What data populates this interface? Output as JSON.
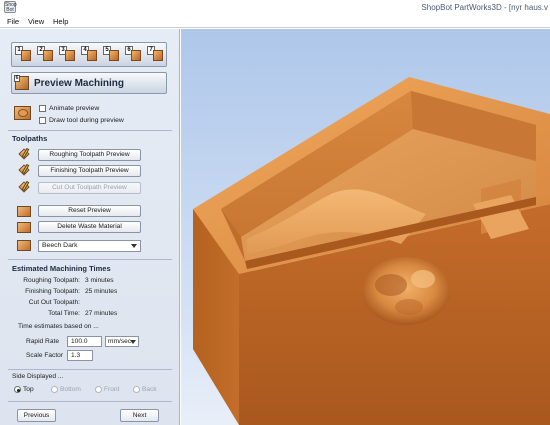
{
  "window": {
    "app_icon_text": "Shop Bot",
    "title": "ShopBot PartWorks3D - [nyr haus.v"
  },
  "menu": [
    "File",
    "View",
    "Help"
  ],
  "steps": [
    {
      "num": "1",
      "icon": "model-step-icon"
    },
    {
      "num": "2",
      "icon": "model-step-icon"
    },
    {
      "num": "3",
      "icon": "model-step-icon"
    },
    {
      "num": "4",
      "icon": "model-step-icon"
    },
    {
      "num": "5",
      "icon": "model-step-icon"
    },
    {
      "num": "6",
      "icon": "model-step-icon"
    },
    {
      "num": "7",
      "icon": "model-step-icon"
    }
  ],
  "section": {
    "num": "6",
    "title": "Preview Machining"
  },
  "options": {
    "animate_preview": "Animate preview",
    "draw_tool": "Draw tool during preview"
  },
  "toolpaths": {
    "heading": "Toolpaths",
    "roughing_btn": "Roughing Toolpath Preview",
    "finishing_btn": "Finishing Toolpath Preview",
    "cutout_btn": "Cut Out Toolpath Preview",
    "reset_btn": "Reset Preview",
    "delete_btn": "Delete Waste Material",
    "material_selected": "Beech Dark"
  },
  "times": {
    "heading": "Estimated Machining Times",
    "rows": [
      {
        "label": "Roughing Toolpath:",
        "value": "3 minutes"
      },
      {
        "label": "Finishing Toolpath:",
        "value": "25 minutes"
      },
      {
        "label": "Cut Out Toolpath:",
        "value": ""
      },
      {
        "label": "Total Time:",
        "value": "27 minutes"
      }
    ],
    "based_on": "Time estimates based on ...",
    "rapid_rate_label": "Rapid Rate",
    "rapid_rate_value": "100.0",
    "rapid_rate_units": "mm/sec",
    "scale_factor_label": "Scale Factor",
    "scale_factor_value": "1.3"
  },
  "side": {
    "heading": "Side Displayed ...",
    "options": [
      "Top",
      "Bottom",
      "Front",
      "Back"
    ],
    "selected": "Top"
  },
  "nav": {
    "previous": "Previous",
    "next": "Next"
  },
  "colors": {
    "wood_light": "#e59a50",
    "wood_mid": "#cf7a33",
    "wood_dark": "#a9591f",
    "viewport_top": "#aec7ea"
  }
}
